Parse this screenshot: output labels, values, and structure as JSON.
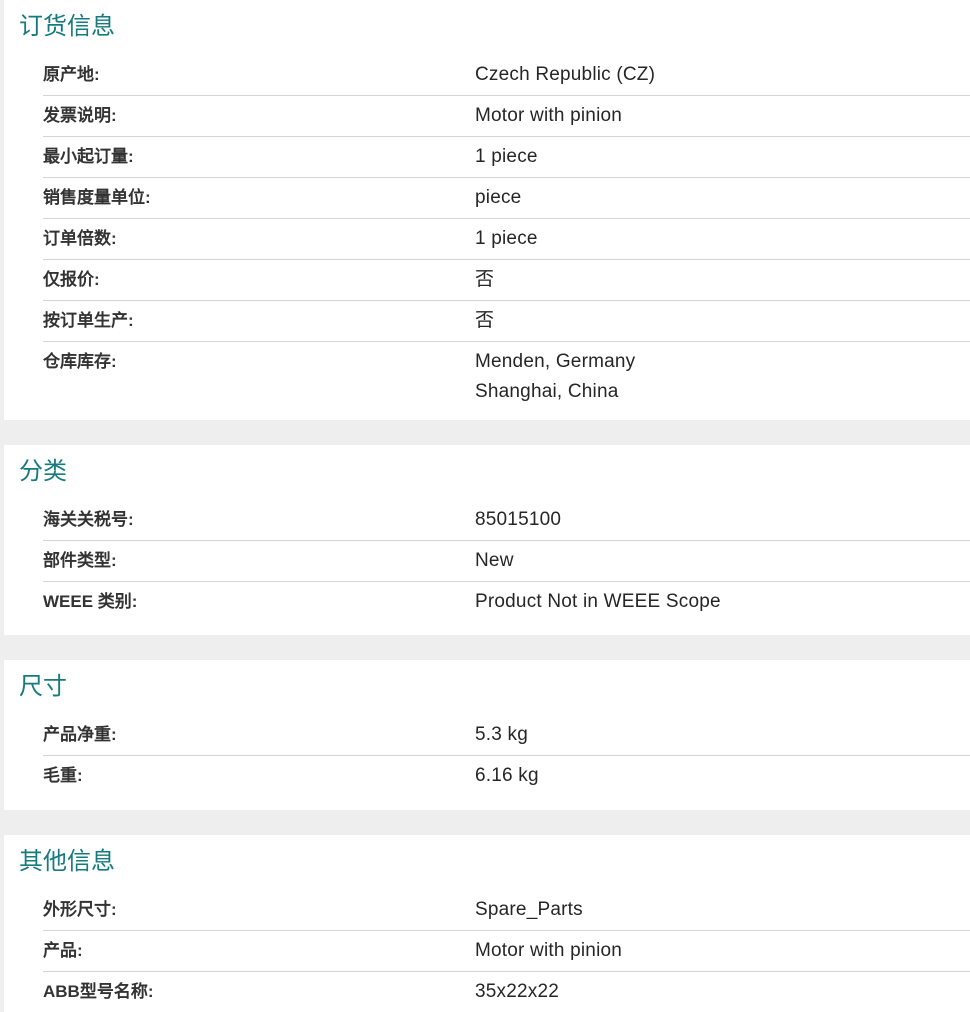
{
  "sections": [
    {
      "title": "订货信息",
      "rows": [
        {
          "label": "原产地:",
          "value": [
            "Czech Republic (CZ)"
          ]
        },
        {
          "label": "发票说明:",
          "value": [
            "Motor with pinion"
          ]
        },
        {
          "label": "最小起订量:",
          "value": [
            "1 piece"
          ]
        },
        {
          "label": "销售度量单位:",
          "value": [
            "piece"
          ]
        },
        {
          "label": "订单倍数:",
          "value": [
            "1 piece"
          ]
        },
        {
          "label": "仅报价:",
          "value": [
            "否"
          ]
        },
        {
          "label": "按订单生产:",
          "value": [
            "否"
          ]
        },
        {
          "label": "仓库库存:",
          "value": [
            "Menden, Germany",
            "Shanghai, China"
          ]
        }
      ]
    },
    {
      "title": "分类",
      "rows": [
        {
          "label": "海关关税号:",
          "value": [
            "85015100"
          ]
        },
        {
          "label": "部件类型:",
          "value": [
            "New"
          ]
        },
        {
          "label": "WEEE 类别:",
          "value": [
            "Product Not in WEEE Scope"
          ]
        }
      ]
    },
    {
      "title": "尺寸",
      "rows": [
        {
          "label": "产品净重:",
          "value": [
            "5.3 kg"
          ]
        },
        {
          "label": "毛重:",
          "value": [
            "6.16 kg"
          ]
        }
      ]
    },
    {
      "title": "其他信息",
      "rows": [
        {
          "label": "外形尺寸:",
          "value": [
            "Spare_Parts"
          ]
        },
        {
          "label": "产品:",
          "value": [
            "Motor with pinion"
          ]
        },
        {
          "label": "ABB型号名称:",
          "value": [
            "35x22x22"
          ]
        }
      ]
    }
  ]
}
